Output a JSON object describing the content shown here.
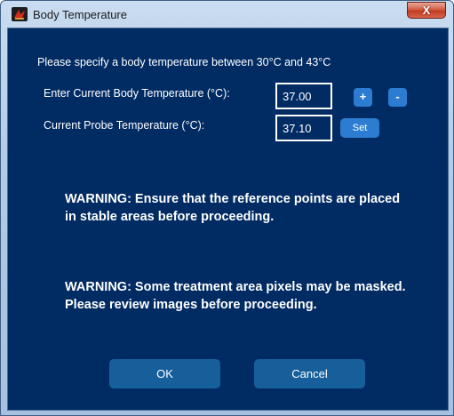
{
  "window": {
    "title": "Body Temperature",
    "close_label": "X",
    "app_icon": "red-app-icon"
  },
  "dialog": {
    "instruction": "Please specify a body temperature between 30°C and 43°C",
    "body_temp_label": "Enter Current Body Temperature (°C):",
    "body_temp_value": "37.00",
    "plus_label": "+",
    "minus_label": "-",
    "probe_temp_label": "Current Probe Temperature (°C):",
    "probe_temp_value": "37.10",
    "set_label": "Set",
    "warning_1": "WARNING: Ensure that the reference points are placed in stable areas before proceeding.",
    "warning_2": "WARNING: Some treatment area pixels may be masked.  Please review images before proceeding.",
    "ok_label": "OK",
    "cancel_label": "Cancel"
  },
  "colors": {
    "background": "#002b63",
    "button": "#175f9a",
    "small_button": "#2c7dd2",
    "text": "#ffffff"
  }
}
